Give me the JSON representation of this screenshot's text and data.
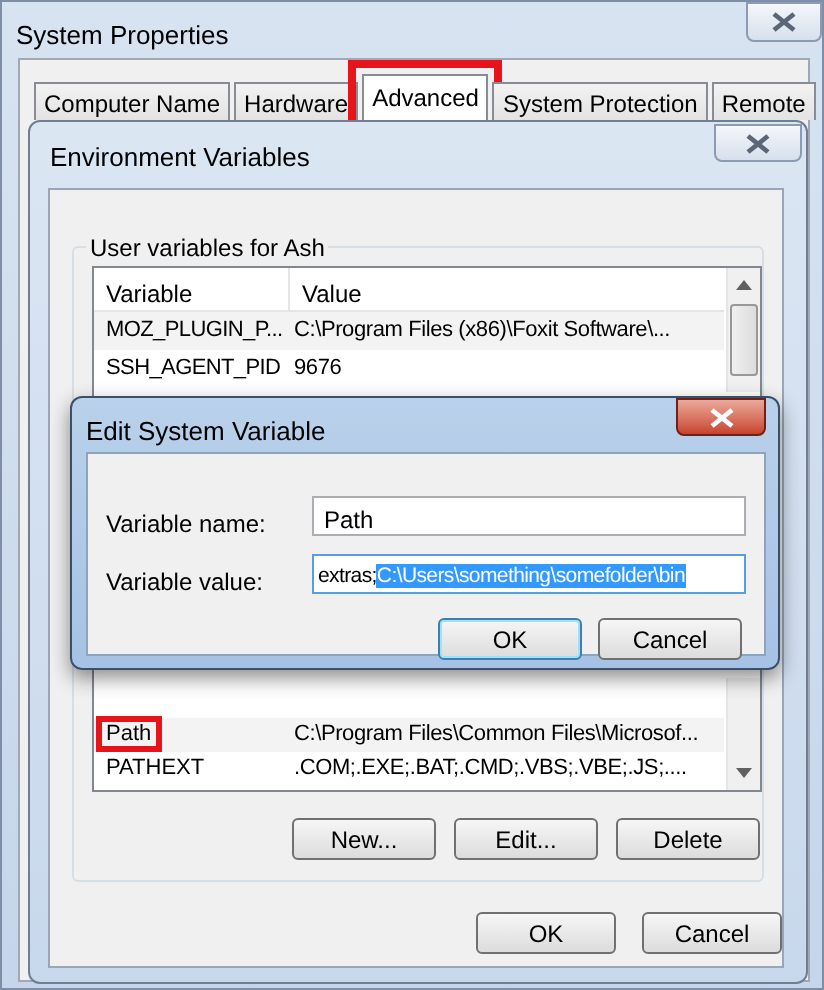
{
  "system_properties": {
    "title": "System Properties",
    "tabs": [
      {
        "label": "Computer Name",
        "selected": false,
        "highlighted": false
      },
      {
        "label": "Hardware",
        "selected": false,
        "highlighted": false
      },
      {
        "label": "Advanced",
        "selected": true,
        "highlighted": true
      },
      {
        "label": "System Protection",
        "selected": false,
        "highlighted": false
      },
      {
        "label": "Remote",
        "selected": false,
        "highlighted": false
      }
    ]
  },
  "environment_variables": {
    "title": "Environment Variables",
    "user_group_title": "User variables for Ash",
    "columns": [
      "Variable",
      "Value"
    ],
    "user_rows": [
      {
        "variable": "MOZ_PLUGIN_P...",
        "value": "C:\\Program Files (x86)\\Foxit Software\\..."
      },
      {
        "variable": "SSH_AGENT_PID",
        "value": "9676"
      }
    ],
    "system_rows": [
      {
        "variable": "Path",
        "value": "C:\\Program Files\\Common Files\\Microsof...",
        "highlighted": true
      },
      {
        "variable": "PATHEXT",
        "value": ".COM;.EXE;.BAT;.CMD;.VBS;.VBE;.JS;....",
        "highlighted": false
      }
    ],
    "list_buttons": [
      "New...",
      "Edit...",
      "Delete"
    ],
    "buttons": [
      "OK",
      "Cancel"
    ]
  },
  "edit_dialog": {
    "title": "Edit System Variable",
    "name_label": "Variable name:",
    "name_value": "Path",
    "value_label": "Variable value:",
    "value_text": "extras;",
    "value_selection": "C:\\Users\\something\\somefolder\\bin",
    "buttons": [
      {
        "label": "OK",
        "default": true
      },
      {
        "label": "Cancel",
        "default": false
      }
    ]
  }
}
